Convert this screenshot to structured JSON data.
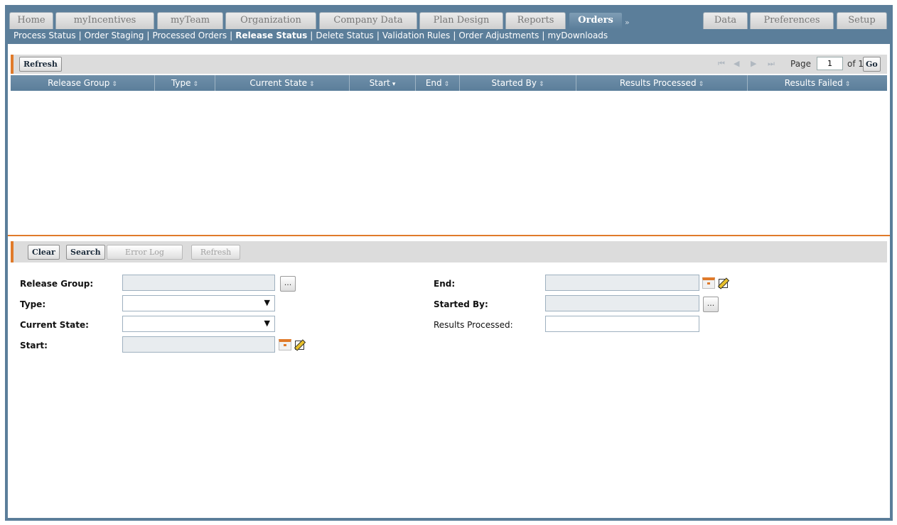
{
  "tabs": [
    {
      "label": "Home"
    },
    {
      "label": "myIncentives"
    },
    {
      "label": "myTeam"
    },
    {
      "label": "Organization"
    },
    {
      "label": "Company Data"
    },
    {
      "label": "Plan Design"
    },
    {
      "label": "Reports"
    },
    {
      "label": "Orders",
      "active": true
    },
    {
      "label": "Data"
    },
    {
      "label": "Preferences"
    },
    {
      "label": "Setup"
    }
  ],
  "tab_overflow_glyph": "»",
  "subnav": {
    "items": [
      {
        "label": "Process Status"
      },
      {
        "label": "Order Staging"
      },
      {
        "label": "Processed Orders"
      },
      {
        "label": "Release Status",
        "active": true
      },
      {
        "label": "Delete Status"
      },
      {
        "label": "Validation Rules"
      },
      {
        "label": "Order Adjustments"
      },
      {
        "label": "myDownloads"
      }
    ],
    "separator": "|"
  },
  "grid_toolbar": {
    "refresh_label": "Refresh",
    "pager": {
      "page_label": "Page",
      "page_value": "1",
      "of_label": "of 1",
      "go_label": "Go"
    }
  },
  "grid": {
    "columns": [
      {
        "label": "Release Group",
        "sort": "⇕"
      },
      {
        "label": "Type",
        "sort": "⇕"
      },
      {
        "label": "Current State",
        "sort": "⇕"
      },
      {
        "label": "Start",
        "sort": "▾"
      },
      {
        "label": "End",
        "sort": "⇕"
      },
      {
        "label": "Started By",
        "sort": "⇕"
      },
      {
        "label": "Results Processed",
        "sort": "⇕"
      },
      {
        "label": "Results Failed",
        "sort": "⇕"
      }
    ],
    "rows": []
  },
  "search_toolbar": {
    "clear_label": "Clear",
    "search_label": "Search",
    "error_log_label": "Error Log",
    "refresh_label": "Refresh"
  },
  "form": {
    "release_group_label": "Release Group:",
    "type_label": "Type:",
    "current_state_label": "Current State:",
    "start_label": "Start:",
    "end_label": "End:",
    "started_by_label": "Started By:",
    "results_processed_label": "Results Processed:",
    "release_group_value": "",
    "type_value": "",
    "current_state_value": "",
    "start_value": "",
    "end_value": "",
    "started_by_value": "",
    "results_processed_value": "",
    "lookup_glyph": "...",
    "select_arrow_glyph": "▼"
  },
  "colors": {
    "frame": "#5b7e9a",
    "accent": "#e07a2a",
    "toolbar": "#dcdcdc"
  }
}
